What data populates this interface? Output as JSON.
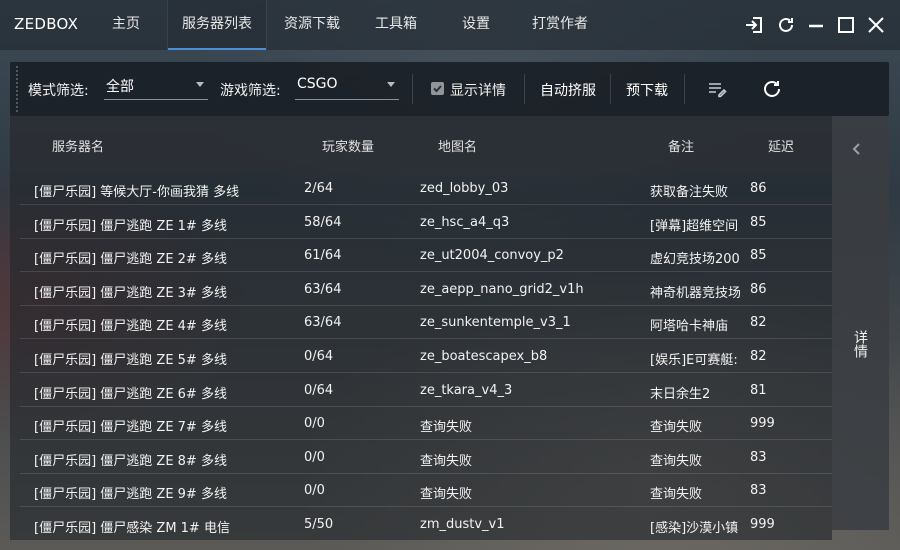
{
  "app": {
    "brand": "ZEDBOX"
  },
  "nav": {
    "tabs": [
      {
        "label": "主页"
      },
      {
        "label": "服务器列表"
      },
      {
        "label": "资源下载"
      },
      {
        "label": "工具箱"
      },
      {
        "label": "设置"
      },
      {
        "label": "打赏作者"
      }
    ],
    "active_index": 1
  },
  "window_controls": [
    "sign-in-icon",
    "refresh-icon",
    "minimize-icon",
    "maximize-icon",
    "close-icon"
  ],
  "toolbar": {
    "mode_filter_label": "模式筛选:",
    "mode_filter_value": "全部",
    "game_filter_label": "游戏筛选:",
    "game_filter_value": "CSGO",
    "show_details_label": "显示详情",
    "show_details_checked": true,
    "auto_squeeze_label": "自动挤服",
    "predownload_label": "预下载",
    "icons": [
      "edit-list-icon",
      "refresh-icon"
    ]
  },
  "table": {
    "headers": {
      "name": "服务器名",
      "players": "玩家数量",
      "map": "地图名",
      "note": "备注",
      "ping": "延迟"
    },
    "rows": [
      {
        "name": "[僵尸乐园] 等候大厅-你画我猜 多线",
        "players": "2/64",
        "map": "zed_lobby_03",
        "note": "获取备注失败",
        "ping": "86"
      },
      {
        "name": "[僵尸乐园] 僵尸逃跑 ZE 1# 多线",
        "players": "58/64",
        "map": "ze_hsc_a4_q3",
        "note": "[弹幕]超维空间",
        "ping": "85"
      },
      {
        "name": "[僵尸乐园] 僵尸逃跑 ZE 2# 多线",
        "players": "61/64",
        "map": "ze_ut2004_convoy_p2",
        "note": "虚幻竞技场200",
        "ping": "85"
      },
      {
        "name": "[僵尸乐园] 僵尸逃跑 ZE 3# 多线",
        "players": "63/64",
        "map": "ze_aepp_nano_grid2_v1h",
        "note": "神奇机器竞技场",
        "ping": "86"
      },
      {
        "name": "[僵尸乐园] 僵尸逃跑 ZE 4# 多线",
        "players": "63/64",
        "map": "ze_sunkentemple_v3_1",
        "note": "阿塔哈卡神庙",
        "ping": "82"
      },
      {
        "name": "[僵尸乐园] 僵尸逃跑 ZE 5# 多线",
        "players": "0/64",
        "map": "ze_boatescapex_b8",
        "note": "[娱乐]E可赛艇:",
        "ping": "82"
      },
      {
        "name": "[僵尸乐园] 僵尸逃跑 ZE 6# 多线",
        "players": "0/64",
        "map": "ze_tkara_v4_3",
        "note": "末日余生2",
        "ping": "81"
      },
      {
        "name": "[僵尸乐园] 僵尸逃跑 ZE 7# 多线",
        "players": "0/0",
        "map": "查询失败",
        "note": "查询失败",
        "ping": "999"
      },
      {
        "name": "[僵尸乐园] 僵尸逃跑 ZE 8# 多线",
        "players": "0/0",
        "map": "查询失败",
        "note": "查询失败",
        "ping": "83"
      },
      {
        "name": "[僵尸乐园] 僵尸逃跑 ZE 9# 多线",
        "players": "0/0",
        "map": "查询失败",
        "note": "查询失败",
        "ping": "83"
      },
      {
        "name": "[僵尸乐园] 僵尸感染 ZM 1# 电信",
        "players": "5/50",
        "map": "zm_dustv_v1",
        "note": "[感染]沙漠小镇",
        "ping": "999"
      }
    ]
  },
  "side_panel": {
    "label": "详情",
    "icon": "chevron-left-icon"
  }
}
